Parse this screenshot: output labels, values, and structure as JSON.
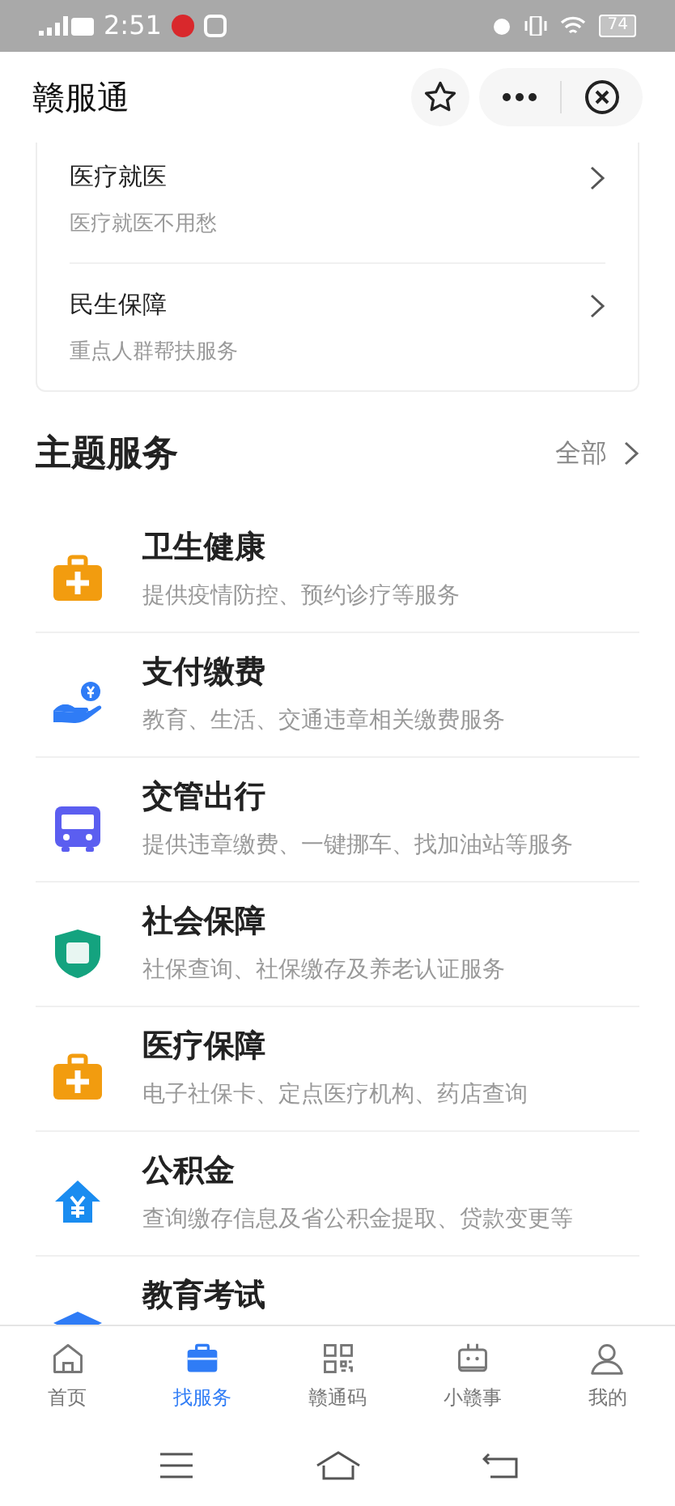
{
  "status_bar": {
    "time": "2:51",
    "battery": "74"
  },
  "header": {
    "title": "赣服通"
  },
  "top_card": {
    "rows": [
      {
        "title": "医疗就医",
        "subtitle": "医疗就医不用愁"
      },
      {
        "title": "民生保障",
        "subtitle": "重点人群帮扶服务"
      }
    ]
  },
  "section": {
    "title": "主题服务",
    "more": "全部"
  },
  "services": [
    {
      "kind": "medkit",
      "title": "卫生健康",
      "description": "提供疫情防控、预约诊疗等服务"
    },
    {
      "kind": "payment",
      "title": "支付缴费",
      "description": "教育、生活、交通违章相关缴费服务"
    },
    {
      "kind": "bus",
      "title": "交管出行",
      "description": "提供违章缴费、一键挪车、找加油站等服务"
    },
    {
      "kind": "shield",
      "title": "社会保障",
      "description": "社保查询、社保缴存及养老认证服务"
    },
    {
      "kind": "medkit",
      "title": "医疗保障",
      "description": "电子社保卡、定点医疗机构、药店查询"
    },
    {
      "kind": "house",
      "title": "公积金",
      "description": "查询缴存信息及省公积金提取、贷款变更等"
    },
    {
      "kind": "cap",
      "title": "教育考试"
    }
  ],
  "tabs": [
    {
      "kind": "home",
      "label": "首页",
      "selected": false
    },
    {
      "kind": "briefcase",
      "label": "找服务",
      "selected": true
    },
    {
      "kind": "qr",
      "label": "赣通码",
      "selected": false
    },
    {
      "kind": "robot",
      "label": "小赣事",
      "selected": false
    },
    {
      "kind": "person",
      "label": "我的",
      "selected": false
    }
  ]
}
